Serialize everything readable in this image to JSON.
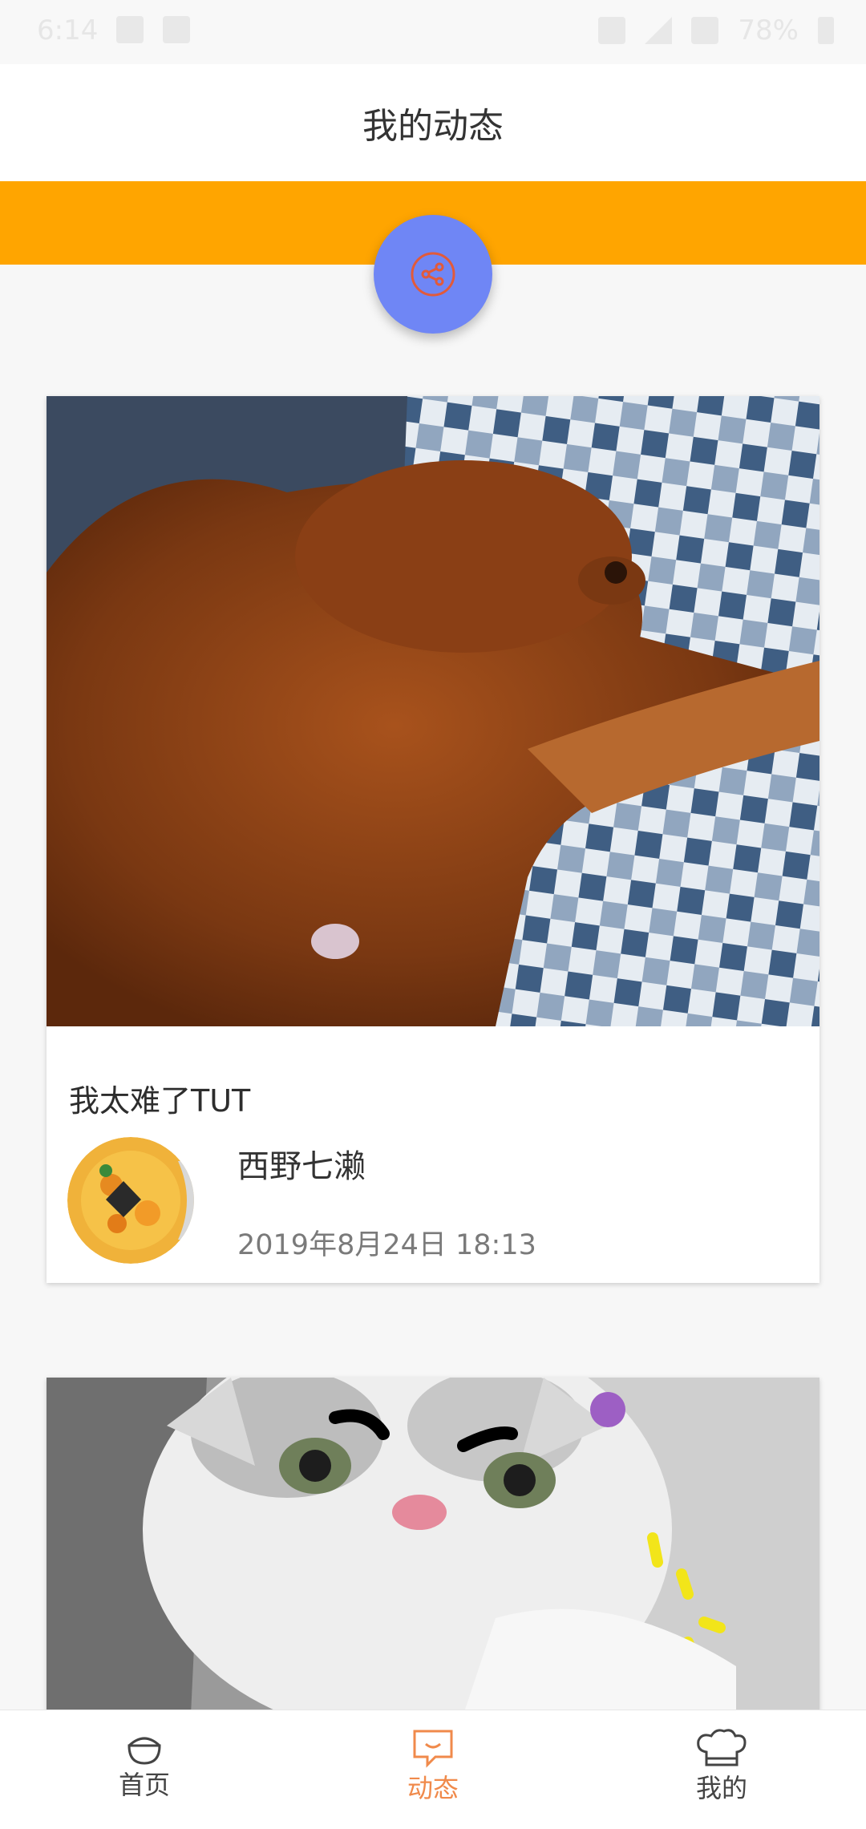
{
  "status_bar": {
    "time": "6:14",
    "battery": "78%",
    "icons": [
      "image-icon",
      "p-icon",
      "vibrate-icon",
      "signal-icon",
      "wifi-icon",
      "battery-icon"
    ]
  },
  "header": {
    "title": "我的动态"
  },
  "share_fab": {
    "icon": "share-icon"
  },
  "posts": [
    {
      "text": "我太难了TUT",
      "author": "西野七濑",
      "time": "2019年8月24日  18:13",
      "photo": "dog-photo",
      "avatar": "cake-avatar"
    },
    {
      "photo": "cat-photo"
    }
  ],
  "bottom_nav": {
    "items": [
      {
        "label": "首页",
        "icon": "bowl-icon"
      },
      {
        "label": "动态",
        "icon": "chat-bubble-icon",
        "active": true
      },
      {
        "label": "我的",
        "icon": "chef-hat-icon"
      }
    ]
  },
  "colors": {
    "accent": "#ffa500",
    "fab": "#6f86f5",
    "active_tab": "#f08a4b"
  }
}
